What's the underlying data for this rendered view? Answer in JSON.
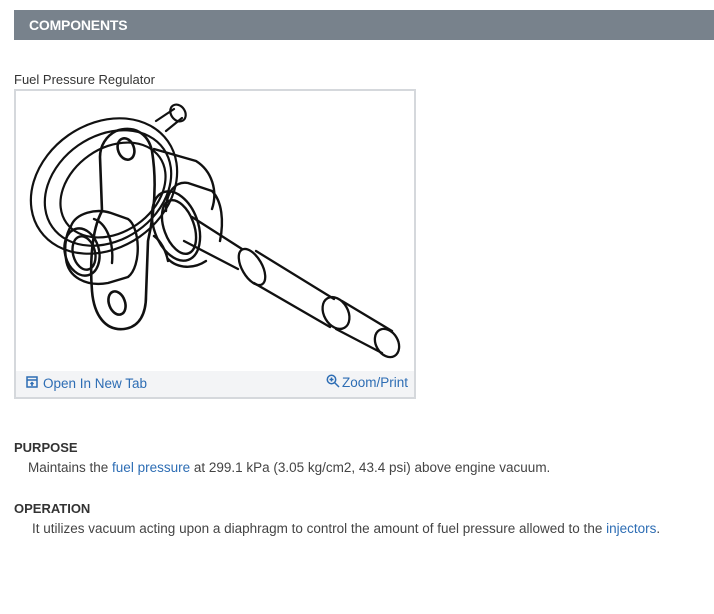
{
  "header": {
    "title": "COMPONENTS"
  },
  "figure": {
    "caption": "Fuel Pressure Regulator",
    "open_tab_label": "Open In New Tab",
    "zoom_label": "Zoom/Print"
  },
  "purpose": {
    "heading": "PURPOSE",
    "text_before": "Maintains the ",
    "link": "fuel pressure",
    "text_after": " at 299.1 kPa (3.05 kg/cm2, 43.4 psi) above engine vacuum."
  },
  "operation": {
    "heading": "OPERATION",
    "text_before": "It utilizes vacuum acting upon a diaphragm to control the amount of fuel pressure allowed to the ",
    "link": "injectors",
    "text_after": "."
  },
  "colors": {
    "header_bg": "#78828c",
    "link": "#2d6db4"
  }
}
